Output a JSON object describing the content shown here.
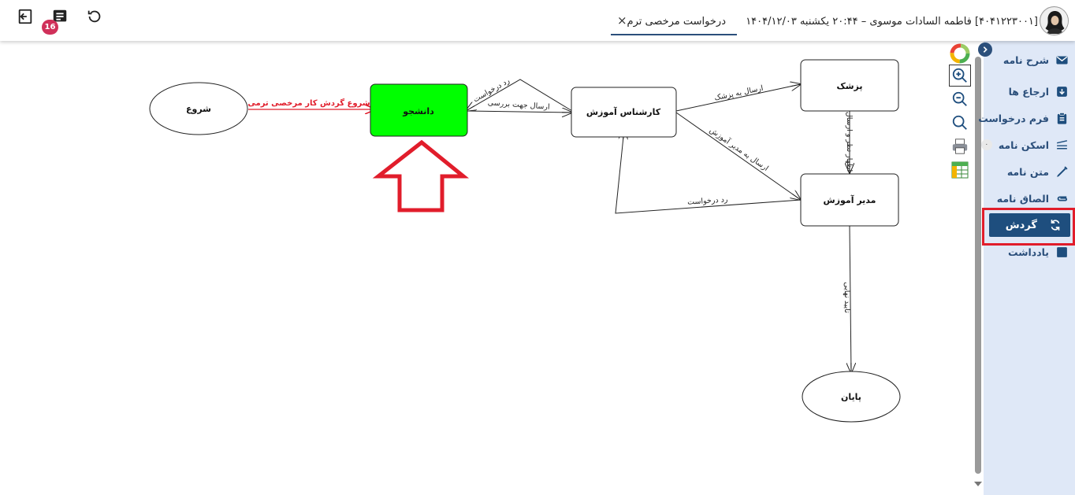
{
  "header": {
    "badge_count": "16",
    "tab_label": "درخواست مرخصی ترم",
    "tab_close": "×",
    "user_info": "[۴۰۴۱۲۲۳۰۰۱] فاطمه السادات موسوی – ۲۰:۴۴ یکشنبه ۱۴۰۴/۱۲/۰۳"
  },
  "sidebar": {
    "items": [
      {
        "label": "شرح نامه",
        "icon": "envelope-icon"
      },
      {
        "label": "ارجاع ها",
        "icon": "forward-icon"
      },
      {
        "label": "فرم درخواست",
        "icon": "clipboard-icon"
      },
      {
        "label": "اسکن نامه",
        "icon": "scanner-icon",
        "count": "۰"
      },
      {
        "label": "متن نامه",
        "icon": "pencil-icon"
      },
      {
        "label": "الصاق نامه",
        "icon": "paperclip-icon"
      },
      {
        "label": "گردش",
        "icon": "sync-icon",
        "active": true
      },
      {
        "label": "یادداشت",
        "icon": "note-icon"
      }
    ]
  },
  "toolbar": [
    "chart-icon",
    "zoom-in-icon",
    "zoom-out-icon",
    "zoom-fit-icon",
    "print-icon",
    "grid-icon"
  ],
  "diagram": {
    "nodes": {
      "start": "شروع",
      "student": "دانشجو",
      "expert": "کارشناس آموزش",
      "doctor": "پزشک",
      "manager": "مدیر آموزش",
      "end": "پایان"
    },
    "edges": {
      "start_to_student": "شروع گردش کار مرخصی ترمی",
      "student_to_expert": "ارسال جهت بررسی",
      "expert_reject": "رد درخواست",
      "expert_to_doctor": "ارسال به پزشک",
      "doctor_to_manager": "اظهار نظر و ارسال",
      "expert_to_manager": "ارسال به مدیر آموزش",
      "manager_reject": "رد درخواست",
      "manager_to_end": "تایید نهایی"
    },
    "colors": {
      "active_node": "#00ff00",
      "start_edge": "#e11d2b",
      "highlight_arrow": "#e11d2b"
    }
  }
}
